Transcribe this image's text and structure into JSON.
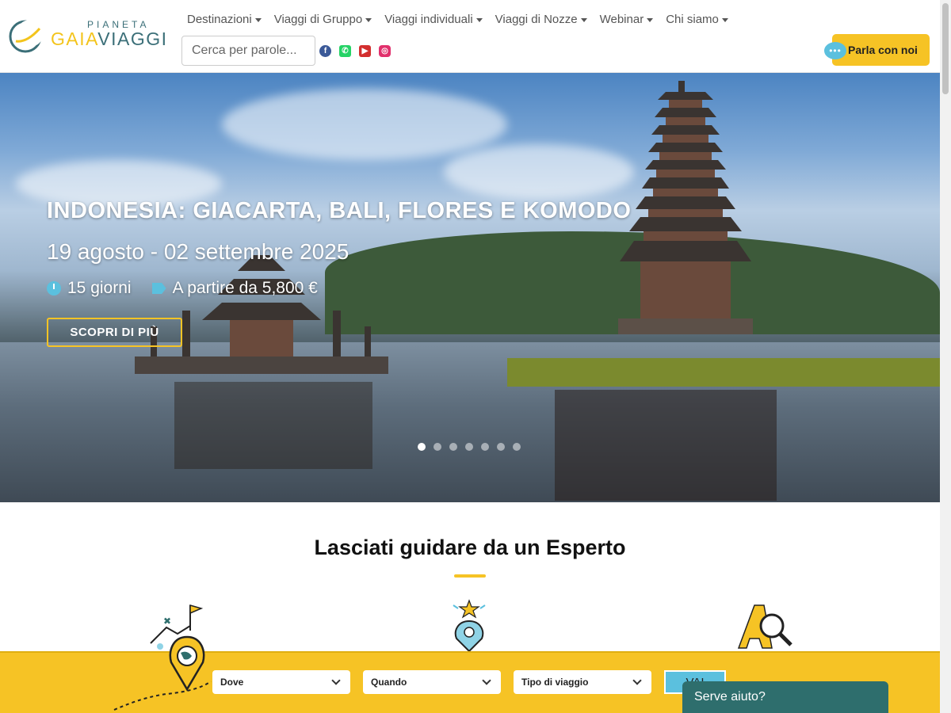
{
  "logo": {
    "top_text": "PIANETA",
    "main_gaia": "GAIA",
    "main_viaggi": "VIAGGI"
  },
  "nav": {
    "items": [
      {
        "label": "Destinazioni"
      },
      {
        "label": "Viaggi di Gruppo"
      },
      {
        "label": "Viaggi individuali"
      },
      {
        "label": "Viaggi di Nozze"
      },
      {
        "label": "Webinar"
      },
      {
        "label": "Chi siamo"
      }
    ]
  },
  "search": {
    "placeholder": "Cerca per parole..."
  },
  "socials": [
    "facebook-icon",
    "whatsapp-icon",
    "youtube-icon",
    "instagram-icon"
  ],
  "talk_button": {
    "label": "Parla con noi",
    "bubble": "•••"
  },
  "hero": {
    "title": "INDONESIA: GIACARTA, BALI, FLORES E KOMODO",
    "dates": "19 agosto - 02 settembre 2025",
    "duration": "15 giorni",
    "price": "A partire da 5,800 €",
    "cta": "SCOPRI DI PIÙ",
    "slides_count": 7,
    "active_slide": 1
  },
  "section": {
    "title": "Lasciati guidare da un Esperto"
  },
  "filters": {
    "dove": "Dove",
    "quando": "Quando",
    "tipo": "Tipo di viaggio",
    "go": "VAI"
  },
  "help": {
    "label": "Serve aiuto?"
  },
  "colors": {
    "accent": "#f6c325",
    "teal": "#2e6e6d",
    "info": "#5bc0de"
  }
}
